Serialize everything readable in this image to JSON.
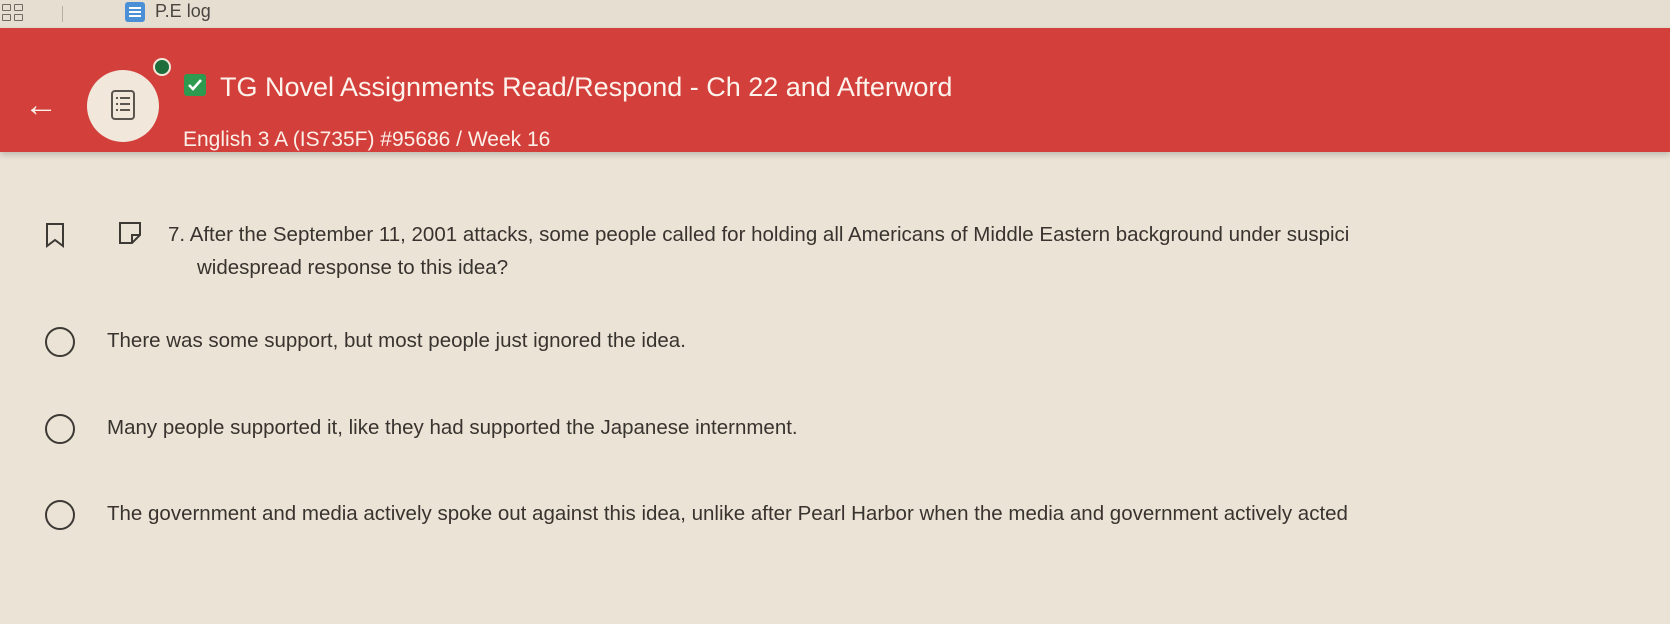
{
  "tab": {
    "label": "P.E log"
  },
  "header": {
    "title": "TG Novel Assignments Read/Respond - Ch 22 and Afterword",
    "subtitle": "English 3 A (IS735F) #95686 / Week 16",
    "accent_color": "#d3403b",
    "check_color": "#2d9a4f",
    "icons": {
      "back": "back-arrow-icon",
      "assignment": "assignment-list-icon",
      "status": "status-dot-icon",
      "completed": "checkmark-icon"
    }
  },
  "question": {
    "number": "7.",
    "line1": "After the September 11, 2001 attacks, some people called for holding all Americans of Middle Eastern background under suspici",
    "line2": "widespread response to this idea?",
    "icons": {
      "bookmark": "bookmark-icon",
      "flag": "flag-icon"
    }
  },
  "choices": [
    {
      "label": "There was some support, but most people just ignored the idea.",
      "selected": false
    },
    {
      "label": "Many people supported it, like they had supported the Japanese internment.",
      "selected": false
    },
    {
      "label": "The government and media actively spoke out against this idea, unlike after Pearl Harbor when the media and government actively acted",
      "selected": false
    }
  ]
}
